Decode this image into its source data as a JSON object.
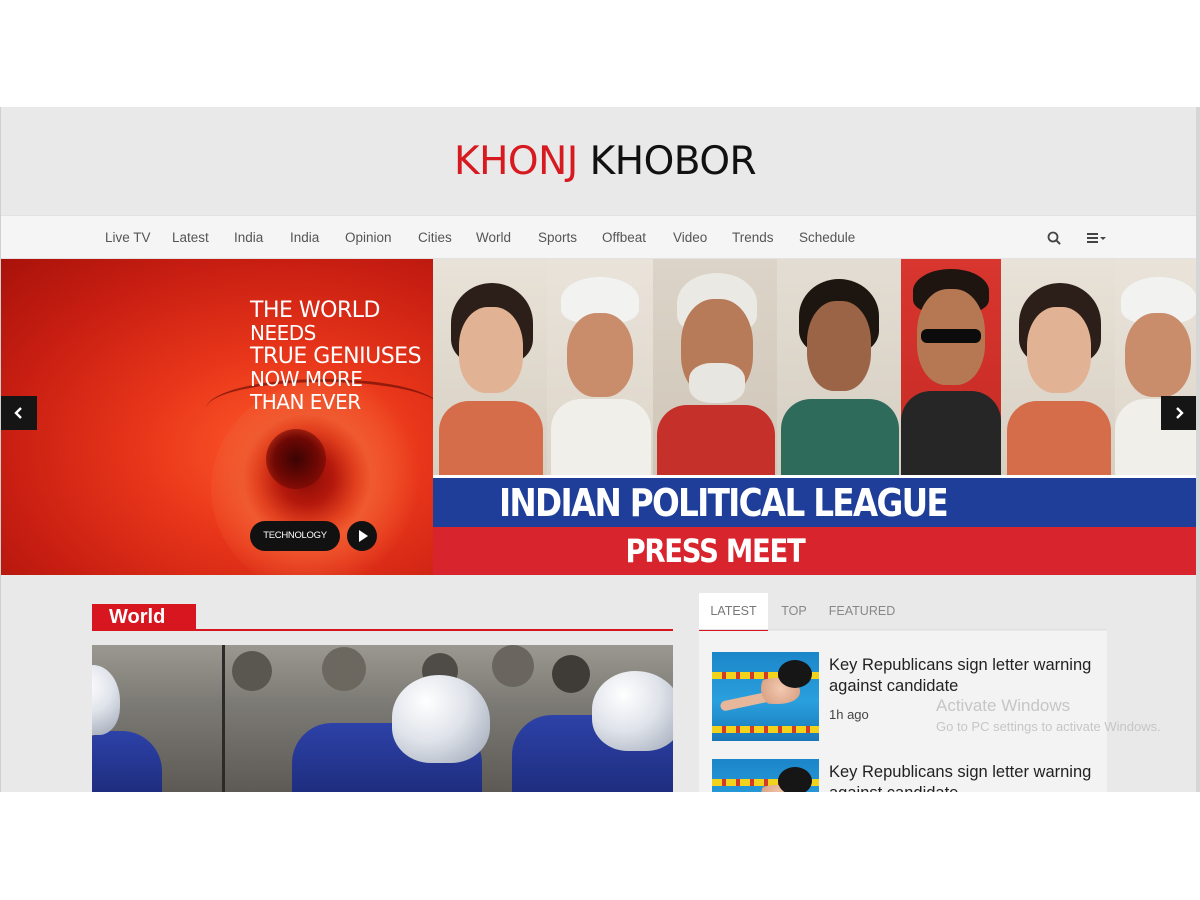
{
  "brand": {
    "logo_part1": "KHONJ",
    "logo_part2": " KHOBOR",
    "logo_red": "#d71920"
  },
  "nav": {
    "items": [
      "Live TV",
      "Latest",
      "India",
      "India",
      "Opinion",
      "Cities",
      "World",
      "Sports",
      "Offbeat",
      "Video",
      "Trends",
      "Schedule"
    ],
    "search_icon": "search-icon",
    "menu_icon": "hamburger-menu-icon"
  },
  "hero": {
    "slogan": [
      "THE WORLD",
      "NEEDS",
      "TRUE GENIUSES",
      "NOW MORE",
      "THAN EVER"
    ],
    "category_button": "TECHNOLOGY",
    "banner_title": "INDIAN POLITICAL LEAGUE",
    "banner_subtitle": "PRESS MEET",
    "banner_blue": "#1f3e99",
    "banner_red": "#d8242d"
  },
  "world_section": {
    "title": "World",
    "accent": "#d8161f"
  },
  "sidebar": {
    "tabs": [
      "LATEST",
      "TOP",
      "FEATURED"
    ],
    "active_tab": "LATEST",
    "news": [
      {
        "title": "Key Republicans sign letter warning against candidate",
        "time": "1h ago"
      },
      {
        "title": "Key Republicans sign letter warning against candidate",
        "time": ""
      }
    ]
  },
  "watermark": {
    "line1": "Activate Windows",
    "line2": "Go to PC settings to activate Windows."
  }
}
